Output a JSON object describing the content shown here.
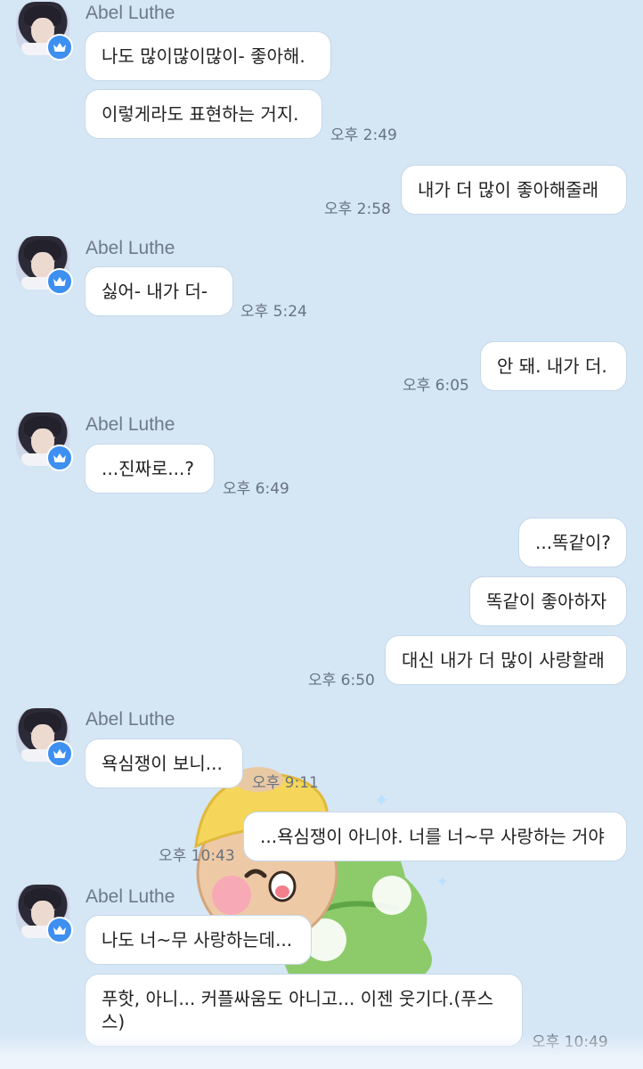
{
  "sender_name": "Abel Luthe",
  "messages": [
    {
      "from": "other",
      "text": "나도 많이많이많이- 좋아해."
    },
    {
      "from": "other",
      "text": "이렇게라도 표현하는 거지.",
      "time": "오후 2:49"
    },
    {
      "from": "me",
      "text": "내가 더 많이 좋아해줄래",
      "time": "오후 2:58"
    },
    {
      "from": "other",
      "text": "싫어- 내가 더-",
      "time": "오후 5:24"
    },
    {
      "from": "me",
      "text": "안 돼. 내가 더.",
      "time": "오후 6:05"
    },
    {
      "from": "other",
      "text": "...진짜로...?",
      "time": "오후 6:49"
    },
    {
      "from": "me",
      "text": "...똑같이?"
    },
    {
      "from": "me",
      "text": "똑같이 좋아하자"
    },
    {
      "from": "me",
      "text": "대신 내가 더 많이 사랑할래",
      "time": "오후 6:50"
    },
    {
      "from": "other",
      "text": "욕심쟁이 보니...",
      "time": "오후 9:11"
    },
    {
      "from": "me",
      "text": "...욕심쟁이 아니야. 너를 너~무 사랑하는 거야",
      "time": "오후 10:43"
    },
    {
      "from": "other",
      "text": "나도 너~무 사랑하는데..."
    },
    {
      "from": "other",
      "text": "푸핫, 아니... 커플싸움도 아니고... 이젠 웃기다.(푸스스)",
      "time": "오후 10:49"
    }
  ],
  "icons": {
    "badge": "crown-icon",
    "sticker": "bear-hugging-tree-sticker"
  },
  "colors": {
    "background": "#d5e6f5",
    "bubble": "#ffffff",
    "badge": "#3d8ff0",
    "name": "#6e7a86",
    "time": "#68737f"
  }
}
